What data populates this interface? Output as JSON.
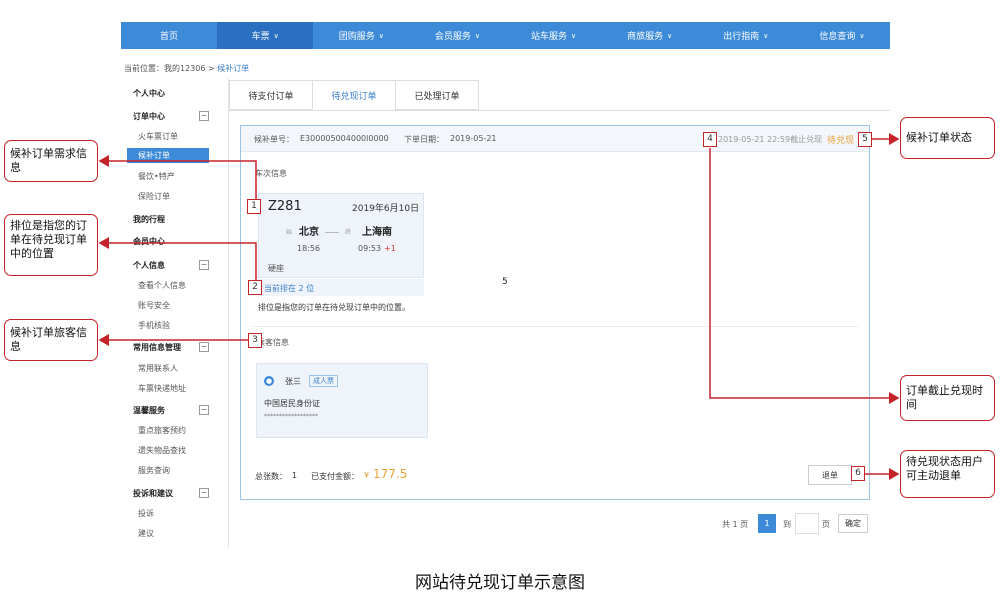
{
  "nav": {
    "items": [
      {
        "label": "首页",
        "chevron": ""
      },
      {
        "label": "车票",
        "chevron": "∨"
      },
      {
        "label": "团购服务",
        "chevron": "∨"
      },
      {
        "label": "会员服务",
        "chevron": "∨"
      },
      {
        "label": "站车服务",
        "chevron": "∨"
      },
      {
        "label": "商旅服务",
        "chevron": "∨"
      },
      {
        "label": "出行指南",
        "chevron": "∨"
      },
      {
        "label": "信息查询",
        "chevron": "∨"
      }
    ],
    "active_color": "#2b6fc0",
    "bar_color": "#3c8ad8"
  },
  "breadcrumb": {
    "prefix": "当前位置：我的12306 > ",
    "current": "候补订单"
  },
  "sidebar": {
    "personal_center": "个人中心",
    "order_center": "订单中心",
    "order_items": [
      "火车票订单",
      "候补订单",
      "餐饮•特产",
      "保险订单"
    ],
    "my_trips": "我的行程",
    "member_center": "会员中心",
    "personal_info": "个人信息",
    "personal_info_items": [
      "查看个人信息",
      "账号安全",
      "手机核验"
    ],
    "common_info": "常用信息管理",
    "common_info_items": [
      "常用联系人",
      "车票快递地址"
    ],
    "warm_service": "温馨服务",
    "warm_service_items": [
      "重点旅客预约",
      "遗失物品查找",
      "服务查询"
    ],
    "complaints": "投诉和建议",
    "complaints_items": [
      "投诉",
      "建议"
    ],
    "toggle_symbol": "−"
  },
  "tabs": [
    "待支付订单",
    "待兑现订单",
    "已处理订单"
  ],
  "order": {
    "order_no_label": "候补单号：",
    "order_no": "E300005004000l0000",
    "order_date_label": "下单日期：",
    "order_date": "2019-05-21",
    "deadline": "2019-05-21 22:59截止兑现",
    "status": "待兑现",
    "trip_section": "车次信息",
    "train_no": "Z281",
    "trip_date": "2019年6月10日",
    "from_tag": "始",
    "from": "北京",
    "to_tag": "终",
    "to": "上海南",
    "depart_time": "18:56",
    "arrive_time": "09:53",
    "day_offset": "+1",
    "seat_type": "硬座",
    "rank_text": "当前排在 2 位",
    "rank_note": "排位是指您的订单在待兑现订单中的位置。",
    "passenger_section": "乘客信息",
    "passenger_name": "张三",
    "passenger_type": "成人票",
    "id_type": "中国居民身份证",
    "id_masked": "******************",
    "total_label": "总张数：",
    "total": "1",
    "paid_label": "已支付金额：",
    "currency": "¥",
    "paid_amount": "177.5",
    "refund_button": "退单",
    "stray_mark": "5",
    "status_color": "#e8a13a",
    "amount_color": "#e8a13a"
  },
  "pagination": {
    "total_pages": "共 1 页",
    "current_page": "1",
    "goto_label": "到",
    "page_unit": "页",
    "confirm": "确定"
  },
  "annotations": [
    {
      "num": "1",
      "text": "候补订单需求信息"
    },
    {
      "num": "2",
      "text": "排位是指您的订单在待兑现订单中的位置"
    },
    {
      "num": "3",
      "text": "候补订单旅客信息"
    },
    {
      "num": "4",
      "text": "订单截止兑现时间"
    },
    {
      "num": "5",
      "text": "候补订单状态"
    },
    {
      "num": "6",
      "text": "待兑现状态用户可主动退单"
    }
  ],
  "annotation_color": "#c5232a",
  "caption": "网站待兑现订单示意图"
}
